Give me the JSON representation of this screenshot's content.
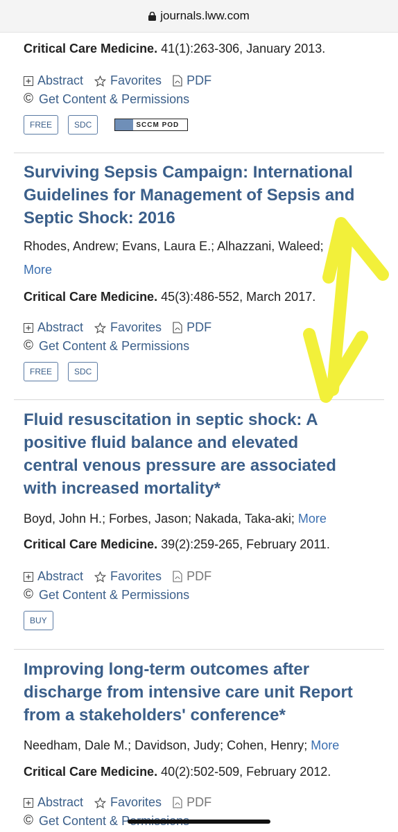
{
  "browser": {
    "url": "journals.lww.com"
  },
  "articles": [
    {
      "journal_name": "Critical Care Medicine.",
      "journal_details": " 41(1):263-306, January 2013.",
      "actions": {
        "abstract": "Abstract",
        "favorites": "Favorites",
        "pdf": "PDF"
      },
      "permissions": "Get Content & Permissions",
      "badges": [
        "FREE",
        "SDC"
      ],
      "sccm_label": "SCCM POD"
    },
    {
      "title": "Surviving Sepsis Campaign: International Guidelines for Management of Sepsis and Septic Shock: 2016",
      "authors": "Rhodes, Andrew; Evans, Laura E.; Alhazzani, Waleed;",
      "more": "More",
      "journal_name": "Critical Care Medicine.",
      "journal_details": " 45(3):486-552, March 2017.",
      "actions": {
        "abstract": "Abstract",
        "favorites": "Favorites",
        "pdf": "PDF"
      },
      "permissions": "Get Content & Permissions",
      "badges": [
        "FREE",
        "SDC"
      ]
    },
    {
      "title": "Fluid resuscitation in septic shock: A positive fluid balance and elevated central venous pressure are associated with increased mortality*",
      "authors": "Boyd, John H.; Forbes, Jason; Nakada, Taka-aki;",
      "more": "More",
      "journal_name": "Critical Care Medicine.",
      "journal_details": " 39(2):259-265, February 2011.",
      "actions": {
        "abstract": "Abstract",
        "favorites": "Favorites",
        "pdf": "PDF"
      },
      "permissions": "Get Content & Permissions",
      "badges": [
        "BUY"
      ]
    },
    {
      "title": "Improving long-term outcomes after discharge from intensive care unit Report from a stakeholders' conference*",
      "authors": "Needham, Dale M.; Davidson, Judy; Cohen, Henry;",
      "more": "More",
      "journal_name": "Critical Care Medicine.",
      "journal_details": " 40(2):502-509, February 2012.",
      "actions": {
        "abstract": "Abstract",
        "favorites": "Favorites",
        "pdf": "PDF"
      },
      "permissions": "Get Content & Permissions"
    }
  ],
  "colors": {
    "title": "#3b5f8a",
    "link": "#3b5f8a",
    "more": "#3b6fb0",
    "annotation": "#f2f03a"
  }
}
